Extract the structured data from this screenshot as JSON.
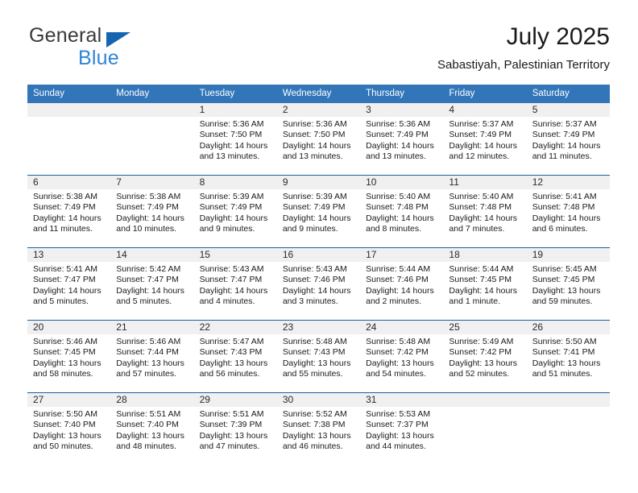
{
  "logo": {
    "word1": "General",
    "word2": "Blue",
    "triangle_color": "#1565b0",
    "word2_color": "#2f86d6"
  },
  "header": {
    "title": "July 2025",
    "subtitle": "Sabastiyah, Palestinian Territory",
    "header_bg_color": "#3275b8",
    "daynum_band_color": "#f0f0f0",
    "row_divider_color": "#1e5f9e"
  },
  "weekday_headers": [
    "Sunday",
    "Monday",
    "Tuesday",
    "Wednesday",
    "Thursday",
    "Friday",
    "Saturday"
  ],
  "weeks": [
    [
      {
        "day": "",
        "sunrise": "",
        "sunset": "",
        "daylight1": "",
        "daylight2": ""
      },
      {
        "day": "",
        "sunrise": "",
        "sunset": "",
        "daylight1": "",
        "daylight2": ""
      },
      {
        "day": "1",
        "sunrise": "Sunrise: 5:36 AM",
        "sunset": "Sunset: 7:50 PM",
        "daylight1": "Daylight: 14 hours",
        "daylight2": "and 13 minutes."
      },
      {
        "day": "2",
        "sunrise": "Sunrise: 5:36 AM",
        "sunset": "Sunset: 7:50 PM",
        "daylight1": "Daylight: 14 hours",
        "daylight2": "and 13 minutes."
      },
      {
        "day": "3",
        "sunrise": "Sunrise: 5:36 AM",
        "sunset": "Sunset: 7:49 PM",
        "daylight1": "Daylight: 14 hours",
        "daylight2": "and 13 minutes."
      },
      {
        "day": "4",
        "sunrise": "Sunrise: 5:37 AM",
        "sunset": "Sunset: 7:49 PM",
        "daylight1": "Daylight: 14 hours",
        "daylight2": "and 12 minutes."
      },
      {
        "day": "5",
        "sunrise": "Sunrise: 5:37 AM",
        "sunset": "Sunset: 7:49 PM",
        "daylight1": "Daylight: 14 hours",
        "daylight2": "and 11 minutes."
      }
    ],
    [
      {
        "day": "6",
        "sunrise": "Sunrise: 5:38 AM",
        "sunset": "Sunset: 7:49 PM",
        "daylight1": "Daylight: 14 hours",
        "daylight2": "and 11 minutes."
      },
      {
        "day": "7",
        "sunrise": "Sunrise: 5:38 AM",
        "sunset": "Sunset: 7:49 PM",
        "daylight1": "Daylight: 14 hours",
        "daylight2": "and 10 minutes."
      },
      {
        "day": "8",
        "sunrise": "Sunrise: 5:39 AM",
        "sunset": "Sunset: 7:49 PM",
        "daylight1": "Daylight: 14 hours",
        "daylight2": "and 9 minutes."
      },
      {
        "day": "9",
        "sunrise": "Sunrise: 5:39 AM",
        "sunset": "Sunset: 7:49 PM",
        "daylight1": "Daylight: 14 hours",
        "daylight2": "and 9 minutes."
      },
      {
        "day": "10",
        "sunrise": "Sunrise: 5:40 AM",
        "sunset": "Sunset: 7:48 PM",
        "daylight1": "Daylight: 14 hours",
        "daylight2": "and 8 minutes."
      },
      {
        "day": "11",
        "sunrise": "Sunrise: 5:40 AM",
        "sunset": "Sunset: 7:48 PM",
        "daylight1": "Daylight: 14 hours",
        "daylight2": "and 7 minutes."
      },
      {
        "day": "12",
        "sunrise": "Sunrise: 5:41 AM",
        "sunset": "Sunset: 7:48 PM",
        "daylight1": "Daylight: 14 hours",
        "daylight2": "and 6 minutes."
      }
    ],
    [
      {
        "day": "13",
        "sunrise": "Sunrise: 5:41 AM",
        "sunset": "Sunset: 7:47 PM",
        "daylight1": "Daylight: 14 hours",
        "daylight2": "and 5 minutes."
      },
      {
        "day": "14",
        "sunrise": "Sunrise: 5:42 AM",
        "sunset": "Sunset: 7:47 PM",
        "daylight1": "Daylight: 14 hours",
        "daylight2": "and 5 minutes."
      },
      {
        "day": "15",
        "sunrise": "Sunrise: 5:43 AM",
        "sunset": "Sunset: 7:47 PM",
        "daylight1": "Daylight: 14 hours",
        "daylight2": "and 4 minutes."
      },
      {
        "day": "16",
        "sunrise": "Sunrise: 5:43 AM",
        "sunset": "Sunset: 7:46 PM",
        "daylight1": "Daylight: 14 hours",
        "daylight2": "and 3 minutes."
      },
      {
        "day": "17",
        "sunrise": "Sunrise: 5:44 AM",
        "sunset": "Sunset: 7:46 PM",
        "daylight1": "Daylight: 14 hours",
        "daylight2": "and 2 minutes."
      },
      {
        "day": "18",
        "sunrise": "Sunrise: 5:44 AM",
        "sunset": "Sunset: 7:45 PM",
        "daylight1": "Daylight: 14 hours",
        "daylight2": "and 1 minute."
      },
      {
        "day": "19",
        "sunrise": "Sunrise: 5:45 AM",
        "sunset": "Sunset: 7:45 PM",
        "daylight1": "Daylight: 13 hours",
        "daylight2": "and 59 minutes."
      }
    ],
    [
      {
        "day": "20",
        "sunrise": "Sunrise: 5:46 AM",
        "sunset": "Sunset: 7:45 PM",
        "daylight1": "Daylight: 13 hours",
        "daylight2": "and 58 minutes."
      },
      {
        "day": "21",
        "sunrise": "Sunrise: 5:46 AM",
        "sunset": "Sunset: 7:44 PM",
        "daylight1": "Daylight: 13 hours",
        "daylight2": "and 57 minutes."
      },
      {
        "day": "22",
        "sunrise": "Sunrise: 5:47 AM",
        "sunset": "Sunset: 7:43 PM",
        "daylight1": "Daylight: 13 hours",
        "daylight2": "and 56 minutes."
      },
      {
        "day": "23",
        "sunrise": "Sunrise: 5:48 AM",
        "sunset": "Sunset: 7:43 PM",
        "daylight1": "Daylight: 13 hours",
        "daylight2": "and 55 minutes."
      },
      {
        "day": "24",
        "sunrise": "Sunrise: 5:48 AM",
        "sunset": "Sunset: 7:42 PM",
        "daylight1": "Daylight: 13 hours",
        "daylight2": "and 54 minutes."
      },
      {
        "day": "25",
        "sunrise": "Sunrise: 5:49 AM",
        "sunset": "Sunset: 7:42 PM",
        "daylight1": "Daylight: 13 hours",
        "daylight2": "and 52 minutes."
      },
      {
        "day": "26",
        "sunrise": "Sunrise: 5:50 AM",
        "sunset": "Sunset: 7:41 PM",
        "daylight1": "Daylight: 13 hours",
        "daylight2": "and 51 minutes."
      }
    ],
    [
      {
        "day": "27",
        "sunrise": "Sunrise: 5:50 AM",
        "sunset": "Sunset: 7:40 PM",
        "daylight1": "Daylight: 13 hours",
        "daylight2": "and 50 minutes."
      },
      {
        "day": "28",
        "sunrise": "Sunrise: 5:51 AM",
        "sunset": "Sunset: 7:40 PM",
        "daylight1": "Daylight: 13 hours",
        "daylight2": "and 48 minutes."
      },
      {
        "day": "29",
        "sunrise": "Sunrise: 5:51 AM",
        "sunset": "Sunset: 7:39 PM",
        "daylight1": "Daylight: 13 hours",
        "daylight2": "and 47 minutes."
      },
      {
        "day": "30",
        "sunrise": "Sunrise: 5:52 AM",
        "sunset": "Sunset: 7:38 PM",
        "daylight1": "Daylight: 13 hours",
        "daylight2": "and 46 minutes."
      },
      {
        "day": "31",
        "sunrise": "Sunrise: 5:53 AM",
        "sunset": "Sunset: 7:37 PM",
        "daylight1": "Daylight: 13 hours",
        "daylight2": "and 44 minutes."
      },
      {
        "day": "",
        "sunrise": "",
        "sunset": "",
        "daylight1": "",
        "daylight2": ""
      },
      {
        "day": "",
        "sunrise": "",
        "sunset": "",
        "daylight1": "",
        "daylight2": ""
      }
    ]
  ]
}
